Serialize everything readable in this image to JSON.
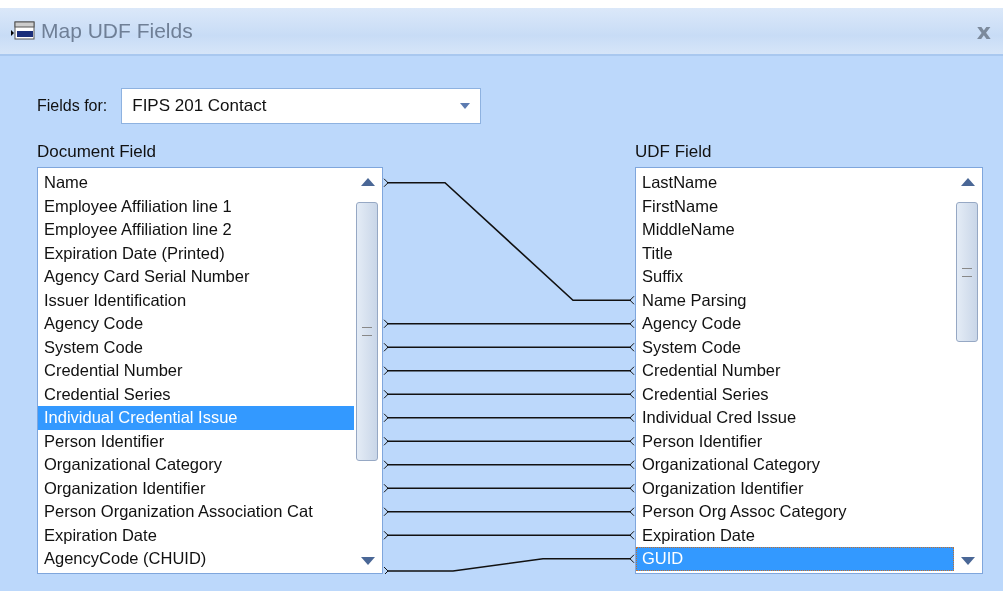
{
  "window": {
    "title": "Map UDF Fields",
    "close": "x"
  },
  "fields_for": {
    "label": "Fields for:",
    "value": "FIPS 201 Contact"
  },
  "document_field": {
    "label": "Document Field",
    "mapped_below": true,
    "items": [
      {
        "text": "Name",
        "selected": false,
        "mapped": true
      },
      {
        "text": "Employee Affiliation line 1",
        "selected": false,
        "mapped": false
      },
      {
        "text": "Employee Affiliation line 2",
        "selected": false,
        "mapped": false
      },
      {
        "text": "Expiration Date (Printed)",
        "selected": false,
        "mapped": false
      },
      {
        "text": "Agency Card Serial Number",
        "selected": false,
        "mapped": false
      },
      {
        "text": "Issuer Identification",
        "selected": false,
        "mapped": false
      },
      {
        "text": "Agency Code",
        "selected": false,
        "mapped": true
      },
      {
        "text": "System Code",
        "selected": false,
        "mapped": true
      },
      {
        "text": "Credential Number",
        "selected": false,
        "mapped": true
      },
      {
        "text": "Credential Series",
        "selected": false,
        "mapped": true
      },
      {
        "text": "Individual Credential Issue",
        "selected": true,
        "mapped": true
      },
      {
        "text": "Person Identifier",
        "selected": false,
        "mapped": true
      },
      {
        "text": "Organizational Category",
        "selected": false,
        "mapped": true
      },
      {
        "text": "Organization Identifier",
        "selected": false,
        "mapped": true
      },
      {
        "text": "Person Organization Association Cat",
        "selected": false,
        "mapped": true
      },
      {
        "text": "Expiration Date",
        "selected": false,
        "mapped": true
      },
      {
        "text": "AgencyCode (CHUID)",
        "selected": false,
        "mapped": false
      }
    ]
  },
  "udf_field": {
    "label": "UDF Field",
    "items": [
      {
        "text": "LastName",
        "selected": false,
        "mapped": false
      },
      {
        "text": "FirstName",
        "selected": false,
        "mapped": false
      },
      {
        "text": "MiddleName",
        "selected": false,
        "mapped": false
      },
      {
        "text": "Title",
        "selected": false,
        "mapped": false
      },
      {
        "text": "Suffix",
        "selected": false,
        "mapped": false
      },
      {
        "text": "Name Parsing",
        "selected": false,
        "mapped": true
      },
      {
        "text": "Agency Code",
        "selected": false,
        "mapped": true
      },
      {
        "text": "System Code",
        "selected": false,
        "mapped": true
      },
      {
        "text": "Credential Number",
        "selected": false,
        "mapped": true
      },
      {
        "text": "Credential Series",
        "selected": false,
        "mapped": true
      },
      {
        "text": "Individual Cred Issue",
        "selected": false,
        "mapped": true
      },
      {
        "text": "Person Identifier",
        "selected": false,
        "mapped": true
      },
      {
        "text": "Organizational Category",
        "selected": false,
        "mapped": true
      },
      {
        "text": "Organization Identifier",
        "selected": false,
        "mapped": true
      },
      {
        "text": "Person Org Assoc Category",
        "selected": false,
        "mapped": true
      },
      {
        "text": "Expiration Date",
        "selected": false,
        "mapped": true
      },
      {
        "text": "GUID",
        "selected": true,
        "mapped": true
      }
    ]
  }
}
